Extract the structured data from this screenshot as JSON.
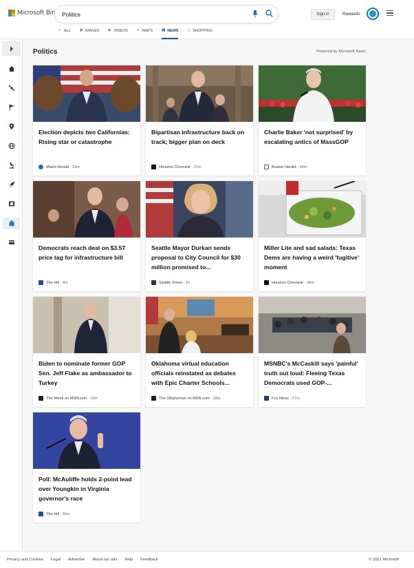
{
  "header": {
    "logo_text": "Microsoft Bing",
    "search_value": "Politics",
    "signin_label": "Sign in",
    "rewards_label": "Rewards"
  },
  "tabs": [
    {
      "label": "ALL",
      "icon": "search-icon"
    },
    {
      "label": "IMAGES",
      "icon": "image-icon"
    },
    {
      "label": "VIDEOS",
      "icon": "video-icon"
    },
    {
      "label": "MAPS",
      "icon": "map-pin-icon"
    },
    {
      "label": "NEWS",
      "icon": "news-icon",
      "active": true
    },
    {
      "label": "SHOPPING",
      "icon": "shopping-bag-icon"
    }
  ],
  "sidebar": {
    "items": [
      {
        "icon": "home-icon"
      },
      {
        "icon": "satellite-icon"
      },
      {
        "icon": "flag-icon"
      },
      {
        "icon": "location-icon"
      },
      {
        "icon": "globe-icon"
      },
      {
        "icon": "microscope-icon"
      },
      {
        "icon": "rocket-icon"
      },
      {
        "icon": "film-icon"
      },
      {
        "icon": "government-icon",
        "active": true
      },
      {
        "icon": "credit-card-icon"
      }
    ]
  },
  "main": {
    "section_title": "Politics",
    "powered_by": "Powered by Microsoft News",
    "cards": [
      {
        "title": "Election depicts two Californias: Rising star or catastrophe",
        "source": "Miami Herald",
        "time": "19m",
        "source_color": "#1a6fb5"
      },
      {
        "title": "Bipartisan infrastructure back on track; bigger plan on deck",
        "source": "Houston Chronicle",
        "time": "21m",
        "source_color": "#111111"
      },
      {
        "title": "Charlie Baker 'not surprised' by escalating antics of MassGOP",
        "source": "Boston Herald",
        "time": "48m",
        "source_color": "#2a5ca8"
      },
      {
        "title": "Democrats reach deal on $3.5T price tag for infrastructure bill",
        "source": "The Hill",
        "time": "8m",
        "source_color": "#1e4f9a"
      },
      {
        "title": "Seattle Mayor Durkan sends proposal to City Council for $30 million promised to...",
        "source": "Seattle Times",
        "time": "1h",
        "source_color": "#333333"
      },
      {
        "title": "Miller Lite and sad salads: Texas Dems are having a weird 'fugitive' moment",
        "source": "Houston Chronicle",
        "time": "38m",
        "source_color": "#111111"
      },
      {
        "title": "Biden to nominate former GOP Sen. Jeff Flake as ambassador to Turkey",
        "source": "The Week on MSN.com",
        "time": "18m",
        "source_color": "#222222"
      },
      {
        "title": "Oklahoma virtual education officials reinstated as debates with Epic Charter Schools...",
        "source": "The Oklahoman on MSN.com",
        "time": "18m",
        "source_color": "#222222"
      },
      {
        "title": "MSNBC's McCaskill says 'painful' truth out loud: Fleeing Texas Democrats used GOP-...",
        "source": "Fox News",
        "time": "57m",
        "source_color": "#1b3a7a"
      },
      {
        "title": "Poll: McAuliffe holds 2-point lead over Youngkin in Virginia governor's race",
        "source": "The Hill",
        "time": "56m",
        "source_color": "#1e4f9a"
      }
    ]
  },
  "footer": {
    "links": [
      "Privacy and Cookies",
      "Legal",
      "Advertise",
      "About our ads",
      "Help",
      "Feedback"
    ],
    "copyright": "© 2021 Microsoft"
  }
}
